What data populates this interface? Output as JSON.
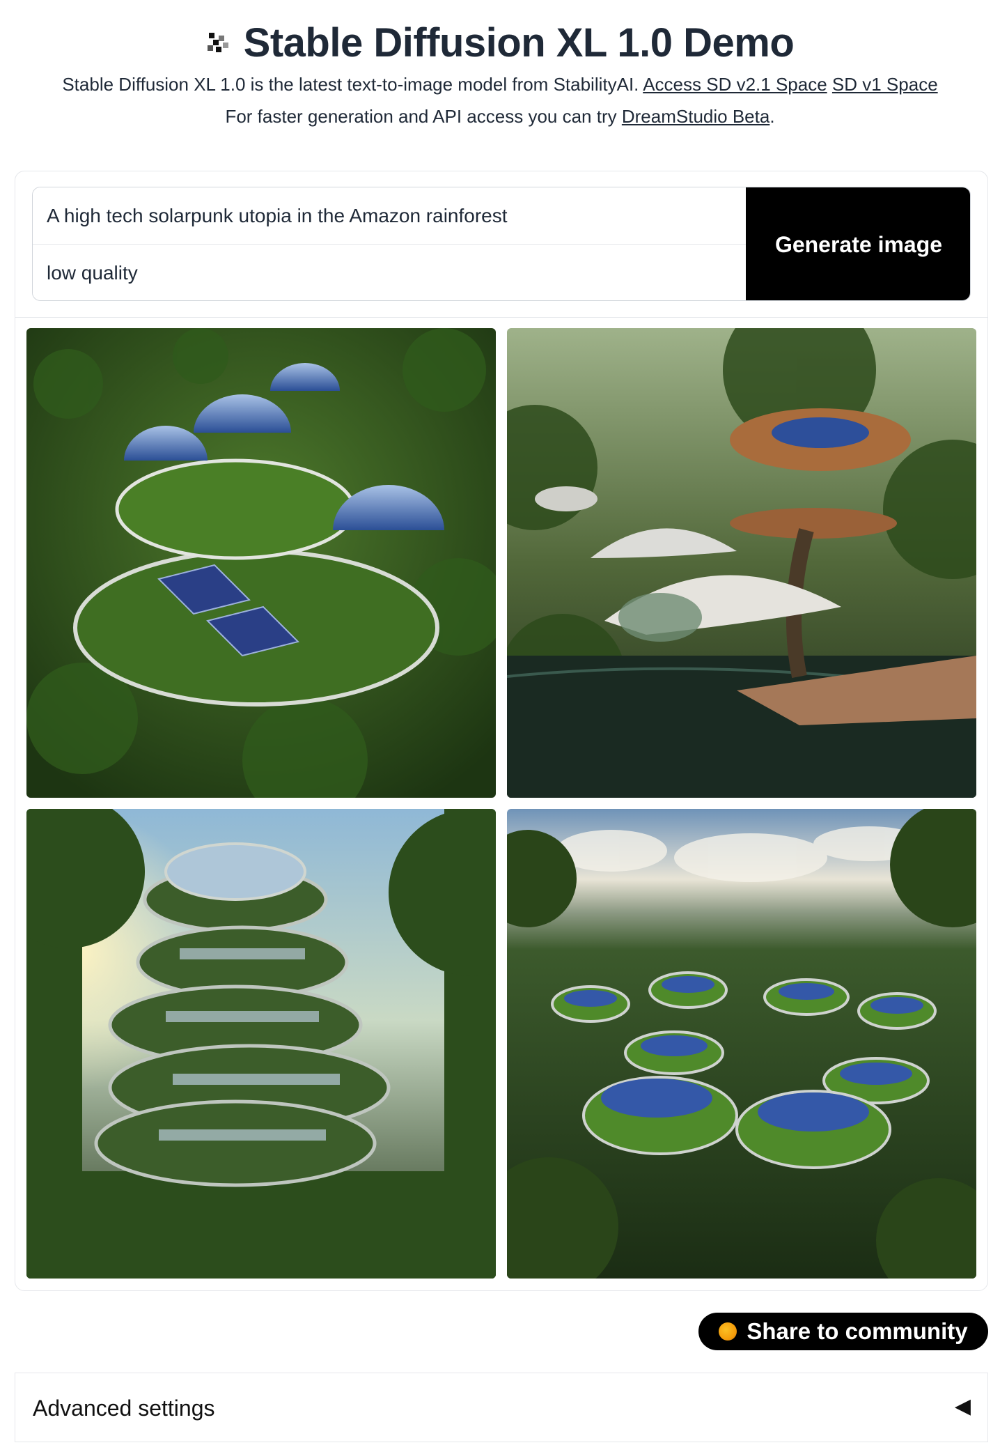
{
  "header": {
    "title": "Stable Diffusion XL 1.0 Demo",
    "description": "Stable Diffusion XL 1.0 is the latest text-to-image model from StabilityAI.",
    "link_sd21": "Access SD v2.1 Space",
    "link_sd1": "SD v1 Space",
    "faster_text": "For faster generation and API access you can try",
    "link_dreamstudio": "DreamStudio Beta",
    "period": "."
  },
  "form": {
    "prompt_value": "A high tech solarpunk utopia in the Amazon rainforest",
    "negative_value": "low quality",
    "generate_label": "Generate image"
  },
  "gallery": {
    "images": [
      "solarpunk-domes-aerial",
      "tree-canopy-pavilions",
      "tiered-green-tower",
      "solar-pod-cluster"
    ]
  },
  "share": {
    "label": "Share to community"
  },
  "advanced": {
    "label": "Advanced settings",
    "arrow": "◀"
  },
  "colors": {
    "accent": "#000000",
    "text": "#1f2937",
    "border": "#e5e7eb"
  }
}
